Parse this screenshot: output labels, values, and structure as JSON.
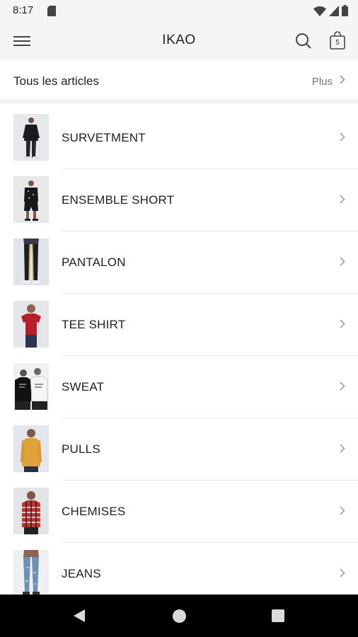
{
  "status_bar": {
    "time": "8:17",
    "icons": [
      "sd-card-icon",
      "wifi-icon",
      "signal-icon",
      "battery-icon"
    ]
  },
  "app_bar": {
    "title": "IKAO",
    "cart_count": "5",
    "icons": [
      "menu-icon",
      "search-icon",
      "shopping-bag-icon"
    ]
  },
  "section": {
    "title": "Tous les articles",
    "more_label": "Plus"
  },
  "categories": [
    {
      "label": "SURVETMENT"
    },
    {
      "label": "ENSEMBLE SHORT"
    },
    {
      "label": "PANTALON"
    },
    {
      "label": "TEE SHIRT"
    },
    {
      "label": "SWEAT"
    },
    {
      "label": "PULLS"
    },
    {
      "label": "CHEMISES"
    },
    {
      "label": "JEANS"
    }
  ],
  "nav_bar": {
    "icons": [
      "back-icon",
      "home-icon",
      "recents-icon"
    ]
  },
  "colors": {
    "app_bar_bg": "#f5f5f5",
    "text": "#212121",
    "muted": "#777777",
    "divider": "#e6e6e6",
    "nav_bg": "#000000"
  }
}
